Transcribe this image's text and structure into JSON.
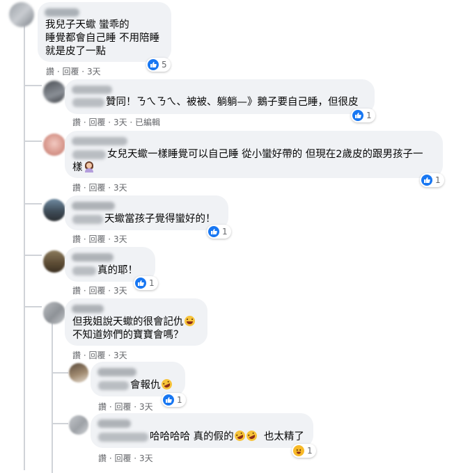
{
  "comments": [
    {
      "id": "c1",
      "lines": [
        "我兒子天蠍 蠻乖的",
        "睡覺都會自己睡 不用陪睡",
        "就是皮了一點"
      ],
      "actions": {
        "like": "讚",
        "reply": "回覆",
        "time": "3天"
      },
      "reaction": {
        "type": "like",
        "count": "5"
      }
    },
    {
      "id": "c2",
      "lines": [
        "贊同！ㄋㄟㄋㄟ、被被、躺躺—》鵝子要自己睡，但很皮"
      ],
      "actions": {
        "like": "讚",
        "reply": "回覆",
        "time": "3天",
        "edited": "已編輯"
      },
      "reaction": {
        "type": "like",
        "count": "1"
      }
    },
    {
      "id": "c3",
      "lines": [
        "女兒天蠍一樣睡覺可以自己睡 從小蠻好帶的 但現在2歲皮的跟男孩子一",
        "樣"
      ],
      "actions": {
        "like": "讚",
        "reply": "回覆",
        "time": "3天"
      },
      "reaction": {
        "type": "like",
        "count": "1"
      }
    },
    {
      "id": "c4",
      "lines": [
        "天蠍當孩子覺得蠻好的！"
      ],
      "actions": {
        "like": "讚",
        "reply": "回覆",
        "time": "3天"
      },
      "reaction": {
        "type": "like",
        "count": "1"
      }
    },
    {
      "id": "c5",
      "lines": [
        "真的耶！"
      ],
      "actions": {
        "like": "讚",
        "reply": "回覆",
        "time": "3天"
      },
      "reaction": {
        "type": "like",
        "count": "1"
      }
    },
    {
      "id": "c6",
      "lines": [
        "但我姐說天蠍的很會記仇",
        "不知道妳們的寶寶會嗎？"
      ],
      "actions": {
        "like": "讚",
        "reply": "回覆",
        "time": "3天"
      }
    },
    {
      "id": "c7",
      "lines": [
        "會報仇"
      ],
      "actions": {
        "like": "讚",
        "reply": "回覆",
        "time": "3天"
      },
      "reaction": {
        "type": "like",
        "count": "1"
      }
    },
    {
      "id": "c8",
      "lines": [
        "哈哈哈哈 真的假的",
        "也太精了"
      ],
      "actions": {
        "like": "讚",
        "reply": "回覆",
        "time": "3天"
      },
      "reaction": {
        "type": "haha",
        "count": "1"
      }
    }
  ],
  "colors": {
    "bubble": "#f0f2f5",
    "meta_text": "#65676b",
    "like_blue": "#1877f2",
    "haha_yellow": "#f7b928"
  },
  "icons": {
    "like": "thumbs-up-icon",
    "haha": "laughing-face-icon",
    "emoji_laugh": "grinning-squinting-face",
    "emoji_rofl": "rolling-on-floor-laughing",
    "emoji_person": "person-shrugging"
  }
}
